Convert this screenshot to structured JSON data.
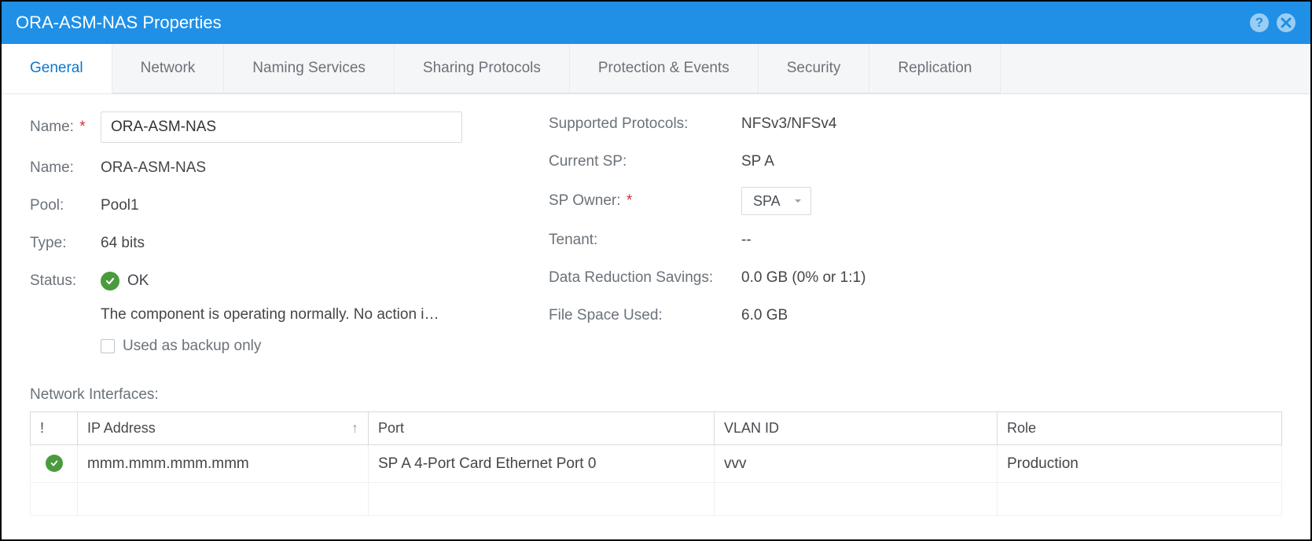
{
  "header": {
    "title": "ORA-ASM-NAS Properties"
  },
  "tabs": {
    "t0": "General",
    "t1": "Network",
    "t2": "Naming Services",
    "t3": "Sharing Protocols",
    "t4": "Protection & Events",
    "t5": "Security",
    "t6": "Replication"
  },
  "left": {
    "name_label": "Name:",
    "name_value": "ORA-ASM-NAS",
    "name2_label": "Name:",
    "name2_value": "ORA-ASM-NAS",
    "pool_label": "Pool:",
    "pool_value": "Pool1",
    "type_label": "Type:",
    "type_value": "64 bits",
    "status_label": "Status:",
    "status_value": "OK",
    "status_desc": "The component is operating normally. No action i…",
    "backup_label": "Used as backup only"
  },
  "right": {
    "proto_label": "Supported Protocols:",
    "proto_value": "NFSv3/NFSv4",
    "cursp_label": "Current SP:",
    "cursp_value": "SP A",
    "spown_label": "SP Owner:",
    "spown_value": "SPA",
    "tenant_label": "Tenant:",
    "tenant_value": "--",
    "drs_label": "Data Reduction Savings:",
    "drs_value": "0.0 GB (0% or 1:1)",
    "fsu_label": "File Space Used:",
    "fsu_value": "6.0 GB"
  },
  "ni": {
    "title": "Network Interfaces:",
    "col_status": "!",
    "col_ip": "IP Address",
    "col_port": "Port",
    "col_vlan": "VLAN ID",
    "col_role": "Role",
    "row0": {
      "ip": "mmm.mmm.mmm.mmm",
      "port": "SP A 4-Port Card Ethernet Port 0",
      "vlan": "vvv",
      "role": "Production"
    }
  }
}
